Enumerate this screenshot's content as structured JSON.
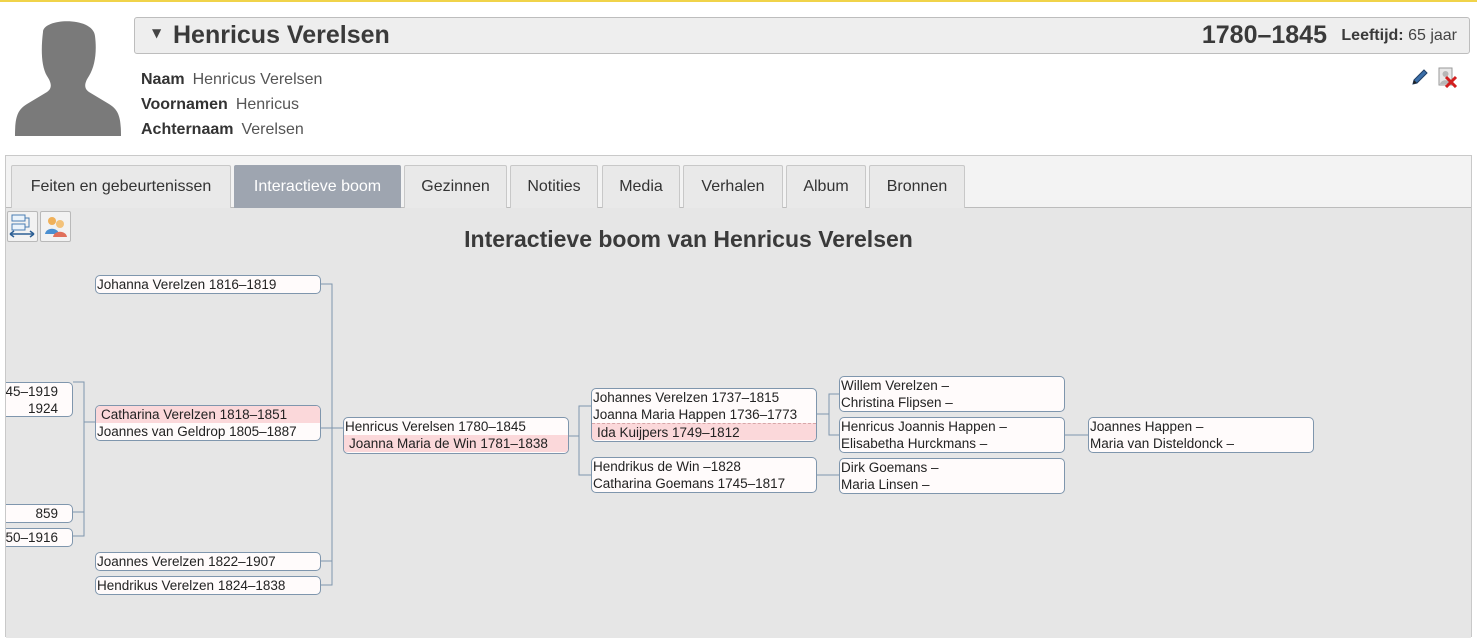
{
  "person": {
    "name": "Henricus Verelsen",
    "years": "1780–1845",
    "age_label": "Leeftijd:",
    "age_value": "65 jaar"
  },
  "facts": [
    {
      "label": "Naam",
      "value": "Henricus Verelsen"
    },
    {
      "label": "Voornamen",
      "value": "Henricus"
    },
    {
      "label": "Achternaam",
      "value": "Verelsen"
    }
  ],
  "tabs": [
    {
      "label": "Feiten en gebeurtenissen",
      "active": false
    },
    {
      "label": "Interactieve boom",
      "active": true
    },
    {
      "label": "Gezinnen",
      "active": false
    },
    {
      "label": "Notities",
      "active": false
    },
    {
      "label": "Media",
      "active": false
    },
    {
      "label": "Verhalen",
      "active": false
    },
    {
      "label": "Album",
      "active": false
    },
    {
      "label": "Bronnen",
      "active": false
    }
  ],
  "tree": {
    "title": "Interactieve boom van Henricus Verelsen",
    "partial_left": [
      "45–1919",
      "1924",
      "859",
      "50–1916"
    ],
    "children": [
      "Johanna Verelzen 1816–1819",
      "Catharina Verelzen 1818–1851",
      "Joannes van Geldrop 1805–1887",
      "Joannes Verelzen 1822–1907",
      "Hendrikus Verelzen 1824–1838"
    ],
    "root": {
      "person": "Henricus Verelsen 1780–1845",
      "spouse": "Joanna Maria de Win 1781–1838"
    },
    "parents_father": {
      "father": "Johannes Verelzen 1737–1815",
      "mother": "Joanna Maria Happen 1736–1773",
      "other_wife": "Ida Kuijpers 1749–1812"
    },
    "parents_mother": {
      "father": "Hendrikus de Win –1828",
      "mother": "Catharina Goemans 1745–1817"
    },
    "grandparents": [
      {
        "father": "Willem Verelzen –",
        "mother": "Christina Flipsen –"
      },
      {
        "father": "Henricus Joannis Happen –",
        "mother": "Elisabetha Hurckmans –"
      },
      {
        "father": "Dirk Goemans –",
        "mother": "Maria Linsen –"
      }
    ],
    "great_grandparents": {
      "father": "Joannes Happen –",
      "mother": "Maria van Disteldonck –"
    }
  },
  "icons": {
    "avatar": "person-silhouette-icon",
    "edit": "pencil-icon",
    "delete": "delete-person-icon",
    "tool1": "tree-layout-icon",
    "tool2": "people-icon",
    "caret": "caret-down-icon"
  }
}
